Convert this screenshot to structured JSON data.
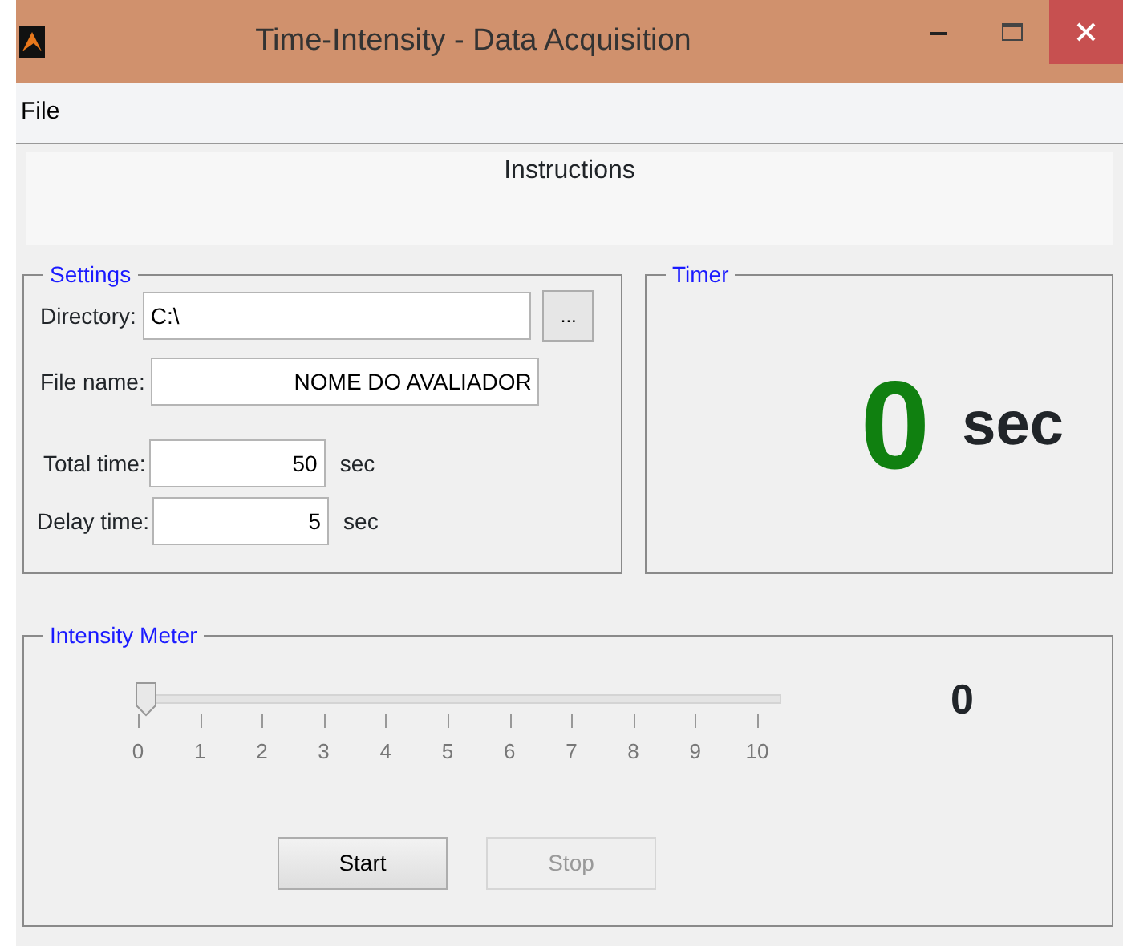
{
  "window": {
    "title": "Time-Intensity - Data Acquisition"
  },
  "menu": [
    {
      "label": "File"
    }
  ],
  "instructions": {
    "text": "Instructions"
  },
  "settings": {
    "title": "Settings",
    "directory": {
      "label": "Directory:",
      "value": "C:\\",
      "browse": "..."
    },
    "file_name": {
      "label": "File name:",
      "value": "NOME DO AVALIADOR"
    },
    "total_time": {
      "label": "Total time:",
      "value": "50",
      "unit": "sec"
    },
    "delay_time": {
      "label": "Delay time:",
      "value": "5",
      "unit": "sec"
    }
  },
  "timer": {
    "title": "Timer",
    "value": "0",
    "unit": "sec"
  },
  "intensity_meter": {
    "title": "Intensity Meter",
    "slider": {
      "level": 0
    },
    "tick_labels": [
      "0",
      "1",
      "2",
      "3",
      "4",
      "5",
      "6",
      "7",
      "8",
      "9",
      "10"
    ],
    "reading": "0",
    "buttons": [
      {
        "label": "Start",
        "disabled": false
      },
      {
        "label": "Stop",
        "disabled": true
      }
    ]
  }
}
